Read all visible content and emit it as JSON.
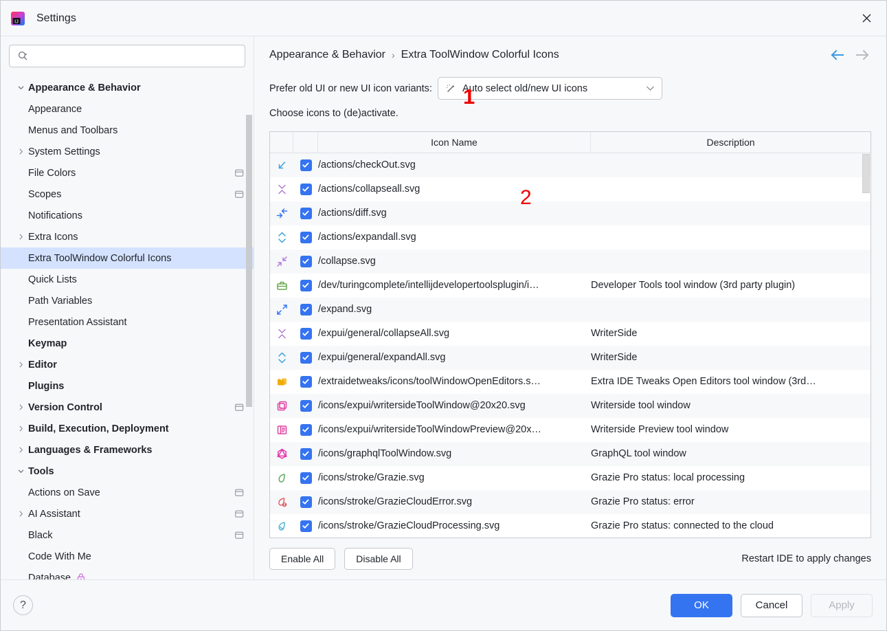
{
  "window": {
    "title": "Settings",
    "logo_icon": "intellij-idea-logo",
    "close_icon": "close-icon"
  },
  "sidebar": {
    "search": {
      "placeholder": "",
      "value": "",
      "icon": "search-icon"
    },
    "items": [
      {
        "label": "Appearance & Behavior",
        "level": 0,
        "bold": true,
        "chevron": "down",
        "selected": false,
        "trailing": ""
      },
      {
        "label": "Appearance",
        "level": 1,
        "bold": false,
        "chevron": "",
        "selected": false,
        "trailing": ""
      },
      {
        "label": "Menus and Toolbars",
        "level": 1,
        "bold": false,
        "chevron": "",
        "selected": false,
        "trailing": ""
      },
      {
        "label": "System Settings",
        "level": 1,
        "bold": false,
        "chevron": "right",
        "selected": false,
        "trailing": ""
      },
      {
        "label": "File Colors",
        "level": 1,
        "bold": false,
        "chevron": "",
        "selected": false,
        "trailing": "project-scope-icon"
      },
      {
        "label": "Scopes",
        "level": 1,
        "bold": false,
        "chevron": "",
        "selected": false,
        "trailing": "project-scope-icon"
      },
      {
        "label": "Notifications",
        "level": 1,
        "bold": false,
        "chevron": "",
        "selected": false,
        "trailing": ""
      },
      {
        "label": "Extra Icons",
        "level": 1,
        "bold": false,
        "chevron": "right",
        "selected": false,
        "trailing": ""
      },
      {
        "label": "Extra ToolWindow Colorful Icons",
        "level": 1,
        "bold": false,
        "chevron": "",
        "selected": true,
        "trailing": ""
      },
      {
        "label": "Quick Lists",
        "level": 1,
        "bold": false,
        "chevron": "",
        "selected": false,
        "trailing": ""
      },
      {
        "label": "Path Variables",
        "level": 1,
        "bold": false,
        "chevron": "",
        "selected": false,
        "trailing": ""
      },
      {
        "label": "Presentation Assistant",
        "level": 1,
        "bold": false,
        "chevron": "",
        "selected": false,
        "trailing": ""
      },
      {
        "label": "Keymap",
        "level": 0,
        "bold": true,
        "chevron": "",
        "selected": false,
        "trailing": ""
      },
      {
        "label": "Editor",
        "level": 0,
        "bold": true,
        "chevron": "right",
        "selected": false,
        "trailing": ""
      },
      {
        "label": "Plugins",
        "level": 0,
        "bold": true,
        "chevron": "",
        "selected": false,
        "trailing": ""
      },
      {
        "label": "Version Control",
        "level": 0,
        "bold": true,
        "chevron": "right",
        "selected": false,
        "trailing": "project-scope-icon"
      },
      {
        "label": "Build, Execution, Deployment",
        "level": 0,
        "bold": true,
        "chevron": "right",
        "selected": false,
        "trailing": ""
      },
      {
        "label": "Languages & Frameworks",
        "level": 0,
        "bold": true,
        "chevron": "right",
        "selected": false,
        "trailing": ""
      },
      {
        "label": "Tools",
        "level": 0,
        "bold": true,
        "chevron": "down",
        "selected": false,
        "trailing": ""
      },
      {
        "label": "Actions on Save",
        "level": 1,
        "bold": false,
        "chevron": "",
        "selected": false,
        "trailing": "project-scope-icon"
      },
      {
        "label": "AI Assistant",
        "level": 1,
        "bold": false,
        "chevron": "right",
        "selected": false,
        "trailing": "project-scope-icon"
      },
      {
        "label": "Black",
        "level": 1,
        "bold": false,
        "chevron": "",
        "selected": false,
        "trailing": "project-scope-icon"
      },
      {
        "label": "Code With Me",
        "level": 1,
        "bold": false,
        "chevron": "",
        "selected": false,
        "trailing": ""
      },
      {
        "label": "Database",
        "level": 1,
        "bold": false,
        "chevron": "",
        "selected": false,
        "trailing": "lock-icon"
      }
    ]
  },
  "main": {
    "breadcrumb": {
      "parent": "Appearance & Behavior",
      "separator": "›",
      "current": "Extra ToolWindow Colorful Icons"
    },
    "nav": {
      "back_icon": "arrow-left-icon",
      "forward_icon": "arrow-right-icon"
    },
    "prefer": {
      "label": "Prefer old UI or new UI icon variants:",
      "combo_value": "Auto select old/new UI icons",
      "combo_icon": "magic-wand-icon",
      "chevron_icon": "chevron-down-icon"
    },
    "choose_line": "Choose icons to (de)activate.",
    "table": {
      "columns": [
        "",
        "",
        "Icon Name",
        "Description"
      ],
      "rows": [
        {
          "icon": "checkout-arrow-icon",
          "icon_color": "#3aa0dd",
          "checked": true,
          "name": "/actions/checkOut.svg",
          "description": ""
        },
        {
          "icon": "collapse-all-icon",
          "icon_color": "#b07cd6",
          "checked": true,
          "name": "/actions/collapseall.svg",
          "description": ""
        },
        {
          "icon": "diff-arrows-icon",
          "icon_color": "#3574f0",
          "checked": true,
          "name": "/actions/diff.svg",
          "description": ""
        },
        {
          "icon": "expand-all-icon",
          "icon_color": "#3aa0dd",
          "checked": true,
          "name": "/actions/expandall.svg",
          "description": ""
        },
        {
          "icon": "collapse-icon",
          "icon_color": "#b07cd6",
          "checked": true,
          "name": "/collapse.svg",
          "description": ""
        },
        {
          "icon": "toolbox-icon",
          "icon_color": "#6aa84f",
          "checked": true,
          "name": "/dev/turingcomplete/intellijdevelopertoolsplugin/i…",
          "description": "Developer Tools tool window (3rd party plugin)"
        },
        {
          "icon": "expand-icon",
          "icon_color": "#3574f0",
          "checked": true,
          "name": "/expand.svg",
          "description": ""
        },
        {
          "icon": "collapse-all-icon",
          "icon_color": "#b07cd6",
          "checked": true,
          "name": "/expui/general/collapseAll.svg",
          "description": "WriterSide"
        },
        {
          "icon": "expand-all-icon",
          "icon_color": "#3aa0dd",
          "checked": true,
          "name": "/expui/general/expandAll.svg",
          "description": "WriterSide"
        },
        {
          "icon": "open-editors-folder-icon",
          "icon_color": "#f0ab00",
          "checked": true,
          "name": "/extraidetweaks/icons/toolWindowOpenEditors.s…",
          "description": "Extra IDE Tweaks Open Editors tool window (3rd…"
        },
        {
          "icon": "writerside-toolwindow-icon",
          "icon_color": "#e040a0",
          "checked": true,
          "name": "/icons/expui/writersideToolWindow@20x20.svg",
          "description": "Writerside tool window"
        },
        {
          "icon": "writerside-preview-icon",
          "icon_color": "#e040a0",
          "checked": true,
          "name": "/icons/expui/writersideToolWindowPreview@20x…",
          "description": "Writerside Preview tool window"
        },
        {
          "icon": "graphql-icon",
          "icon_color": "#e535ab",
          "checked": true,
          "name": "/icons/graphqlToolWindow.svg",
          "description": "GraphQL tool window"
        },
        {
          "icon": "grazie-leaf-icon",
          "icon_color": "#5fa85f",
          "checked": true,
          "name": "/icons/stroke/Grazie.svg",
          "description": "Grazie Pro status: local processing"
        },
        {
          "icon": "grazie-cloud-error-icon",
          "icon_color": "#e05a5a",
          "checked": true,
          "name": "/icons/stroke/GrazieCloudError.svg",
          "description": "Grazie Pro status: error"
        },
        {
          "icon": "grazie-cloud-processing-icon",
          "icon_color": "#52b5d6",
          "checked": true,
          "name": "/icons/stroke/GrazieCloudProcessing.svg",
          "description": "Grazie Pro status: connected to the cloud"
        }
      ]
    },
    "actions": {
      "enable_all": "Enable All",
      "disable_all": "Disable All",
      "restart_note": "Restart IDE to apply changes"
    }
  },
  "footer": {
    "help_label": "?",
    "ok": "OK",
    "cancel": "Cancel",
    "apply": "Apply"
  },
  "annotations": {
    "one": "1",
    "two": "2",
    "color": "#ee0000"
  },
  "colors": {
    "accent": "#3574f0",
    "selection": "#d4e2ff",
    "background": "#f7f8fa",
    "border": "#c9ccd1"
  }
}
